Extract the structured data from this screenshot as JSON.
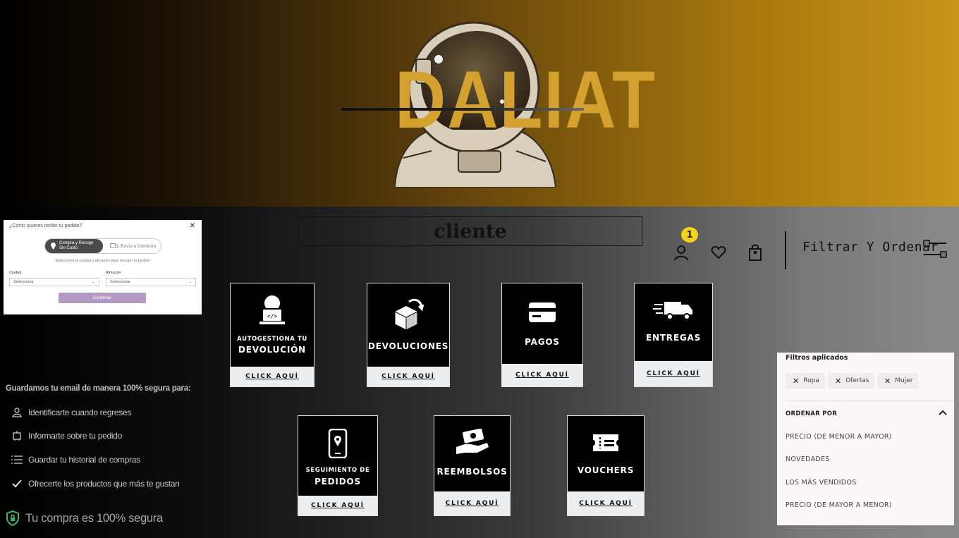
{
  "brand": {
    "name": "DALIAT"
  },
  "search": {
    "value": "cliente"
  },
  "header": {
    "cart_badge": "1",
    "filter_label": "Filtrar Y Ordenar"
  },
  "tiles": [
    {
      "line1": "AUTOGESTIONA TU",
      "line2": "DEVOLUCIÓN",
      "cta": "CLICK AQUÍ",
      "icon": "agent-icon"
    },
    {
      "line1": "",
      "line2": "DEVOLUCIONES",
      "cta": "CLICK AQUÍ",
      "icon": "return-box-icon"
    },
    {
      "line1": "",
      "line2": "PAGOS",
      "cta": "CLICK AQUÍ",
      "icon": "credit-card-icon"
    },
    {
      "line1": "",
      "line2": "ENTREGAS",
      "cta": "CLICK AQUÍ",
      "icon": "truck-icon"
    },
    {
      "line1": "SEGUIMIENTO DE",
      "line2": "PEDIDOS",
      "cta": "CLICK AQUÍ",
      "icon": "phone-location-icon"
    },
    {
      "line1": "",
      "line2": "REEMBOLSOS",
      "cta": "CLICK AQUÍ",
      "icon": "refund-hand-icon"
    },
    {
      "line1": "",
      "line2": "VOUCHERS",
      "cta": "CLICK AQUÍ",
      "icon": "ticket-icon"
    }
  ],
  "modal": {
    "title": "¿Cómo quieres recibir tu pedido?",
    "option_active_line1": "Compra y Recoge",
    "option_active_line2": "Sin Costo",
    "option_inactive": "Envío a Domicilio",
    "subtitle": "Selecciona la ciudad y almacén para recoger tu pedido",
    "city_label": "Ciudad",
    "city_value": "Seleccionar",
    "store_label": "Almacén",
    "store_value": "Seleccionar",
    "confirm": "Confirmar"
  },
  "privacy": {
    "title": "Guardamos tu email de manera 100% segura para:",
    "items": [
      "Identificarte cuando regreses",
      "Informarte sobre tu pedido",
      "Guardar tu historial de compras",
      "Ofrecerte los productos que más te gustan"
    ],
    "secure": "Tu compra es 100% segura"
  },
  "filters": {
    "title": "Filtros aplicados",
    "chips": [
      "Ropa",
      "Ofertas",
      "Mujer"
    ],
    "order_title": "ORDENAR POR",
    "options": [
      "PRECIO (DE MENOR A MAYOR)",
      "NOVEDADES",
      "LOS MÁS VENDIDOS",
      "PRECIO (DE MAYOR A MENOR)"
    ]
  }
}
